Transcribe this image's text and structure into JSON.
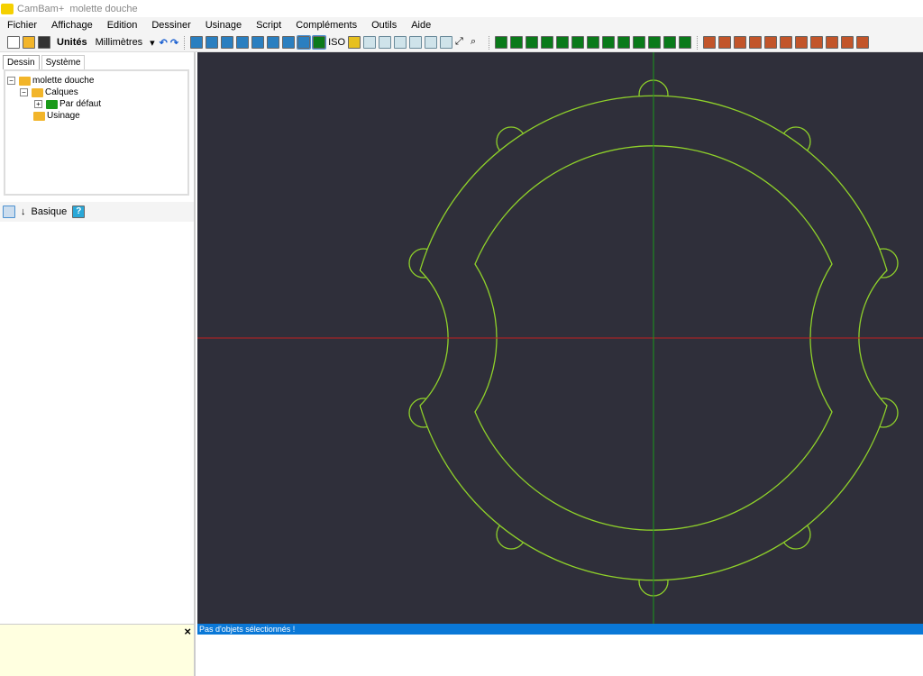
{
  "window": {
    "app": "CamBam+",
    "document": "molette douche"
  },
  "menu": [
    "Fichier",
    "Affichage",
    "Edition",
    "Dessiner",
    "Usinage",
    "Script",
    "Compléments",
    "Outils",
    "Aide"
  ],
  "toolbar": {
    "units_label": "Unités",
    "units_value": "Millimètres",
    "iso_label": "ISO"
  },
  "left_tabs": [
    "Dessin",
    "Système"
  ],
  "tree": {
    "root": "molette douche",
    "layers": "Calques",
    "default_layer": "Par défaut",
    "machining": "Usinage"
  },
  "properties": {
    "mode": "Basique",
    "help": "?"
  },
  "message_panel": {
    "close": "×"
  },
  "status": {
    "text": "Pas d'objets sélectionnés !"
  },
  "colors": {
    "canvas": "#2f2f3a",
    "geometry": "#8fd12a",
    "x_axis": "#c02020",
    "y_axis": "#1a9a1a",
    "status_bar": "#0a78d7"
  }
}
